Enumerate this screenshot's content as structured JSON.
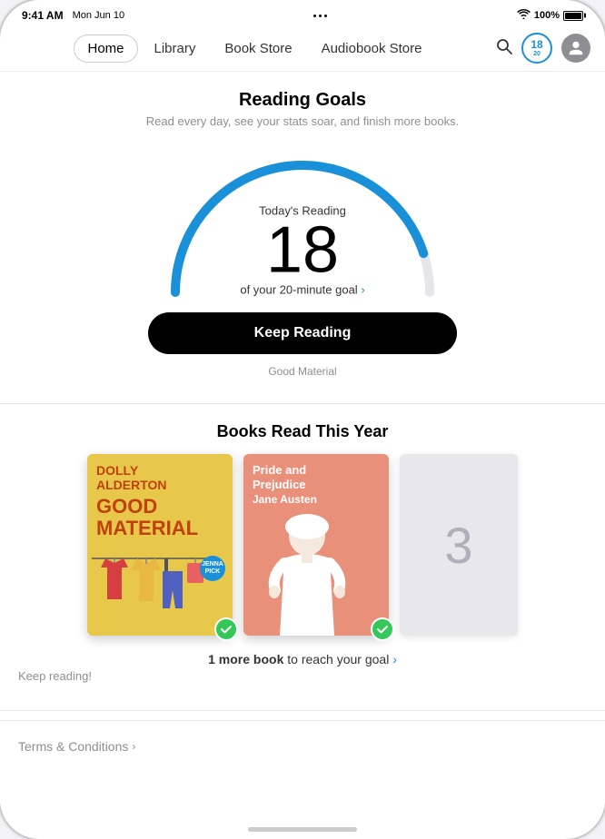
{
  "status_bar": {
    "time": "9:41 AM",
    "day": "Mon Jun 10",
    "battery_pct": "100%"
  },
  "nav": {
    "items": [
      {
        "label": "Home",
        "active": true
      },
      {
        "label": "Library",
        "active": false
      },
      {
        "label": "Book Store",
        "active": false
      },
      {
        "label": "Audiobook Store",
        "active": false
      }
    ],
    "reading_badge": {
      "num": "18",
      "sub": "20"
    },
    "search_label": "Search"
  },
  "reading_goals": {
    "title": "Reading Goals",
    "subtitle": "Read every day, see your stats soar, and finish more books.",
    "today_label": "Today's Reading",
    "minutes": "18",
    "goal_text": "of your 20-minute goal",
    "goal_link": "›",
    "keep_reading_label": "Keep Reading",
    "keep_reading_sub": "Good Material"
  },
  "books_section": {
    "title": "Books Read This Year",
    "books": [
      {
        "title": "DOLLY\nALDERTON\nGOOD\nMATERIAL",
        "author": "",
        "type": "good_material",
        "completed": true
      },
      {
        "title": "Pride and\nPrejudice",
        "author": "Jane Austen",
        "type": "pride_prejudice",
        "completed": true
      },
      {
        "type": "placeholder",
        "number": "3",
        "completed": false
      }
    ],
    "goal_cta": "1 more book",
    "goal_cta_suffix": " to reach your goal ",
    "goal_chevron": "›",
    "goal_keep": "Keep reading!"
  },
  "terms": {
    "label": "Terms & Conditions",
    "chevron": "›"
  }
}
